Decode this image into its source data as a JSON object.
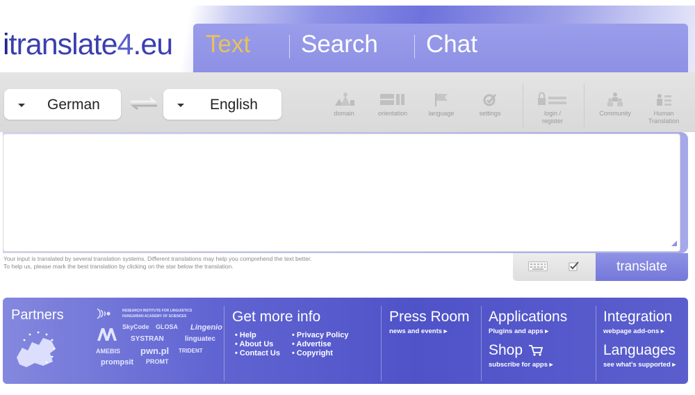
{
  "logo": {
    "i": "i",
    "name": "translate",
    "num": "4",
    "tld": ".eu"
  },
  "tabs": [
    {
      "label": "Text",
      "active": true
    },
    {
      "label": "Search",
      "active": false
    },
    {
      "label": "Chat",
      "active": false
    }
  ],
  "toolbar": {
    "source_language": "German",
    "target_language": "English",
    "tools": [
      {
        "icon": "domain-icon",
        "label": "domain"
      },
      {
        "icon": "orientation-icon",
        "label": "orientation"
      },
      {
        "icon": "language-icon",
        "label": "language"
      },
      {
        "icon": "settings-icon",
        "label": "settings"
      },
      {
        "icon": "login-icon",
        "label": "login /",
        "label2": "register"
      },
      {
        "icon": "community-icon",
        "label": "Community"
      },
      {
        "icon": "human-translation-icon",
        "label": "Human",
        "label2": "Translation"
      }
    ]
  },
  "input": {
    "value": "",
    "placeholder": ""
  },
  "hint": {
    "line1": "Your input is translated by several translation systems. Different translations may help you comprehend the text better.",
    "line2": "To help us, please mark the best translation by clicking on the star below the translation."
  },
  "actions": {
    "translate_label": "translate",
    "keyboard_icon": "keyboard-icon",
    "check_icon": "checkbox-icon"
  },
  "footer": {
    "partners": {
      "title": "Partners",
      "logos": {
        "rilmta_1": "RESEARCH INSTITUTE FOR LINGUISTICS",
        "rilmta_2": "HUNGARIAN ACADEMY OF SCIENCES",
        "skycode": "SkyCode",
        "glosa": "GLOSA",
        "lingenio": "Lingenio",
        "systran": "SYSTRAN",
        "linguatec": "linguatec",
        "amebis": "AMEBIS",
        "pwn": "pwn.pl",
        "trident": "TRIDENT",
        "prompsit": "prompsit",
        "promt": "PROMT"
      }
    },
    "info": {
      "title": "Get more info",
      "links_left": [
        "Help",
        "About Us",
        "Contact Us"
      ],
      "links_right": [
        "Privacy Policy",
        "Advertise",
        "Copyright"
      ]
    },
    "press": {
      "title": "Press Room",
      "sub": "news and events"
    },
    "applications": {
      "title": "Applications",
      "sub": "Plugins and apps"
    },
    "shop": {
      "title": "Shop",
      "sub": "subscribe for apps"
    },
    "integration": {
      "title": "Integration",
      "sub": "webpage add-ons"
    },
    "languages": {
      "title": "Languages",
      "sub": "see what's supported"
    }
  },
  "colors": {
    "accent": "#7478da",
    "active_tab": "#e6c35b",
    "footer": "#5a5ecd"
  }
}
